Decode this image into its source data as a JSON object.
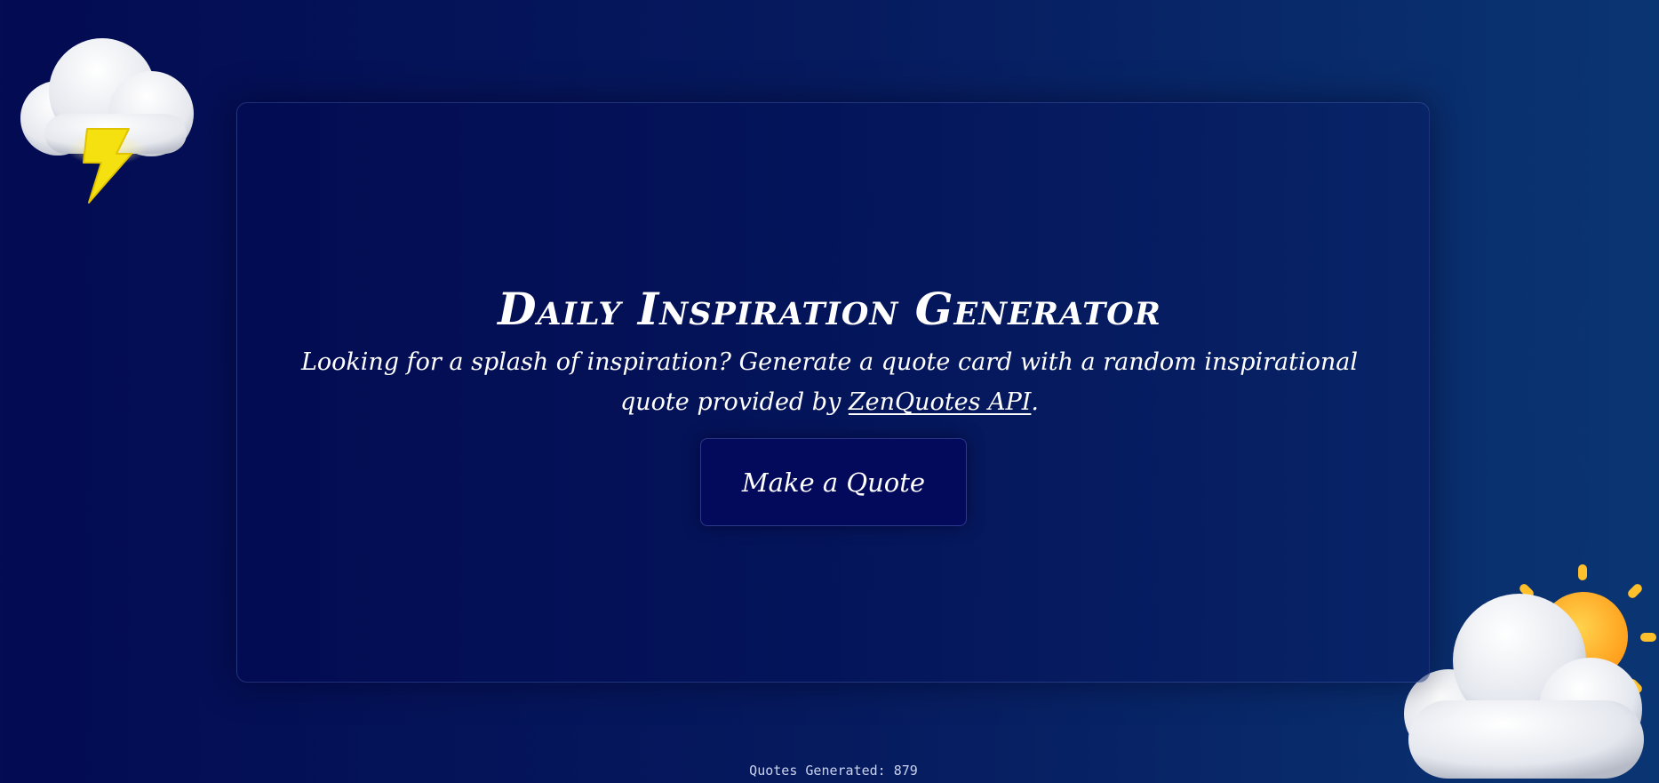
{
  "header": {
    "title": "Daily Inspiration Generator"
  },
  "intro": {
    "text_before_link": "Looking for a splash of inspiration? Generate a quote card with a random inspirational quote provided by ",
    "link_label": "ZenQuotes API",
    "text_after_link": "."
  },
  "actions": {
    "make_quote_label": "Make a Quote"
  },
  "footer": {
    "counter_label": "Quotes Generated: 879"
  },
  "icons": {
    "top_left": "storm-cloud-icon",
    "bottom_right": "sun-behind-cloud-icon"
  },
  "colors": {
    "background_start": "#030b52",
    "background_end": "#0a3573",
    "button_background": "#03095b",
    "lightning": "#f5e10f",
    "sun": "#ffb52a"
  }
}
